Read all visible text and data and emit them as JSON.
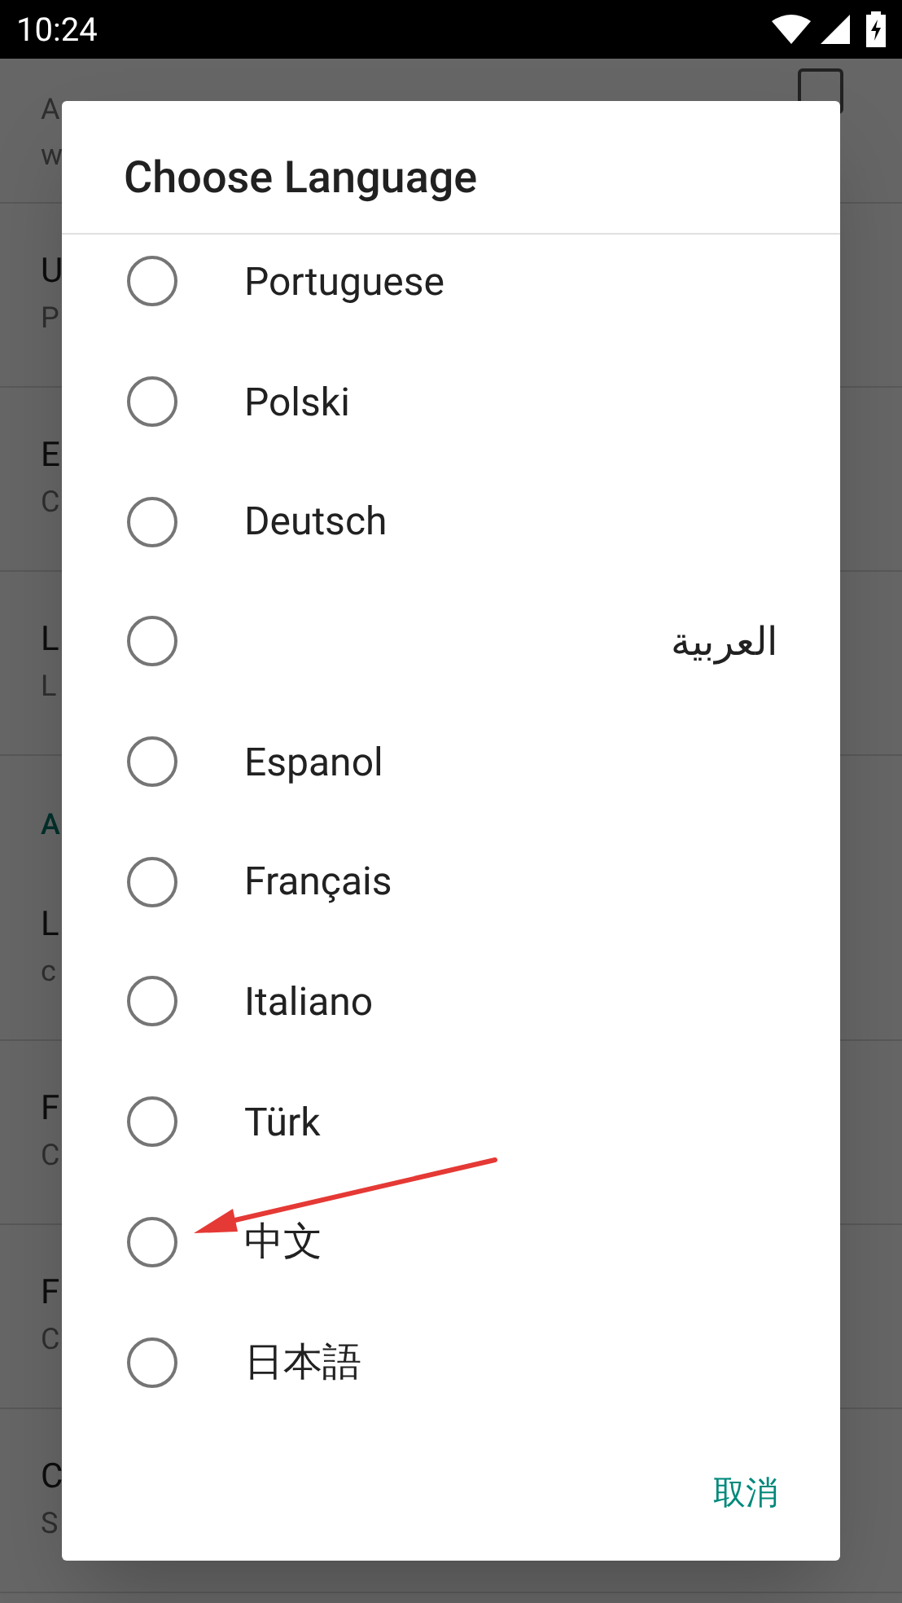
{
  "status_bar": {
    "time": "10:24"
  },
  "settings": [
    {
      "kind": "row",
      "summary": "A",
      "summary_2": "w",
      "checked": false
    },
    {
      "kind": "row",
      "title": "U",
      "summary": "P"
    },
    {
      "kind": "row",
      "title": "E",
      "summary": "C"
    },
    {
      "kind": "row",
      "title": "L",
      "summary": "L"
    },
    {
      "kind": "header",
      "title": "A"
    },
    {
      "kind": "row",
      "title": "L",
      "summary": "c"
    },
    {
      "kind": "row",
      "title": "F",
      "summary": "C"
    },
    {
      "kind": "row",
      "title": "F",
      "summary": "C"
    },
    {
      "kind": "row",
      "title": "C",
      "summary": "S"
    }
  ],
  "dialog": {
    "title": "Choose Language",
    "options": [
      {
        "label": "Portuguese",
        "selected": false,
        "kind": "ltr"
      },
      {
        "label": "Polski",
        "selected": false,
        "kind": "ltr"
      },
      {
        "label": "Deutsch",
        "selected": false,
        "kind": "ltr"
      },
      {
        "label": "العربية",
        "selected": false,
        "kind": "rtl"
      },
      {
        "label": "Espanol",
        "selected": false,
        "kind": "ltr"
      },
      {
        "label": "Français",
        "selected": false,
        "kind": "ltr"
      },
      {
        "label": "Italiano",
        "selected": false,
        "kind": "ltr"
      },
      {
        "label": "Türk",
        "selected": false,
        "kind": "ltr"
      },
      {
        "label": "中文",
        "selected": false,
        "kind": "ltr"
      },
      {
        "label": "日本語",
        "selected": false,
        "kind": "ltr"
      }
    ],
    "cancel_button": "取消"
  }
}
